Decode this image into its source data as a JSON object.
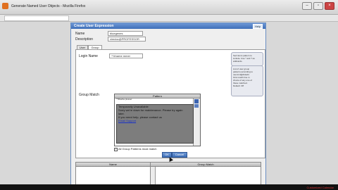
{
  "browser": {
    "title": "Generate Named User Objects - Mozilla Firefox",
    "window_buttons": [
      "–",
      "▫",
      "×"
    ]
  },
  "dialog": {
    "title": "Create User Expression",
    "help_label": "Help",
    "name_label": "Name",
    "name_value": "bluegenes",
    "description_label": "Description",
    "description_value": "ximdoc@PROFESSOR",
    "tabs": [
      {
        "label": "User",
        "active": false
      },
      {
        "label": "Group",
        "active": true
      }
    ],
    "login_name_label": "Login Name",
    "login_name_value": "^*#name mmer",
    "login_help": "Sed items pattern to\ninclude. Use * and ? as\nwildcards.",
    "group_match_label": "Group Match",
    "group_help": "List of user group\npatterns according to\nuserxml@dtdedit.\nFirst match line in\nchoice of any one of\nthese matched.\nDefault: Off",
    "pattern_header": "Pattern",
    "pattern_selected": "^*#barba plosser",
    "error_lines": [
      "Temporarily Unavailable",
      "Sorry we're down for maintenance. Please try again",
      "later.",
      "If you need help, please contact us",
      "Email Support"
    ],
    "all_groups_label": "All Group Patterns must match",
    "all_groups_checked": true,
    "ok_label": "OK",
    "cancel_label": "Cancel"
  },
  "table": {
    "columns": [
      "Name",
      "Group Match"
    ]
  },
  "taskbar": {
    "tray_text": "Customized Calendar"
  }
}
